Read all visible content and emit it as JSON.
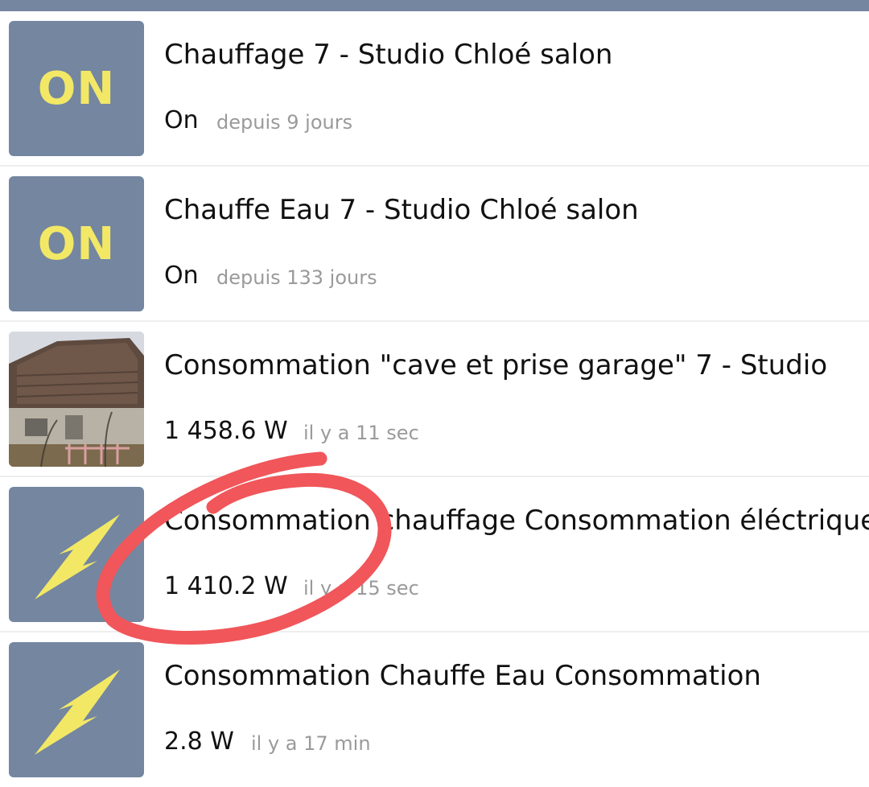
{
  "colors": {
    "tile_background": "#7486a0",
    "tile_accent": "#f2e866",
    "annotation_stroke": "#f0565a"
  },
  "devices": [
    {
      "icon": "on-state-icon",
      "icon_text": "ON",
      "title": "Chauffage 7 - Studio Chloé salon",
      "value": "On",
      "time": "depuis 9 jours"
    },
    {
      "icon": "on-state-icon",
      "icon_text": "ON",
      "title": "Chauffe Eau 7 - Studio Chloé salon",
      "value": "On",
      "time": "depuis 133 jours"
    },
    {
      "icon": "house-photo",
      "title": "Consommation \"cave et prise garage\" 7 - Studio",
      "value": "1 458.6 W",
      "time": "il y a 11 sec"
    },
    {
      "icon": "lightning-bolt-icon",
      "title": "Consommation chauffage Consommation éléctrique",
      "value": "1 410.2 W",
      "time": "il y a 15 sec"
    },
    {
      "icon": "lightning-bolt-icon",
      "title": "Consommation Chauffe Eau Consommation",
      "value": "2.8 W",
      "time": "il y a 17 min"
    }
  ]
}
